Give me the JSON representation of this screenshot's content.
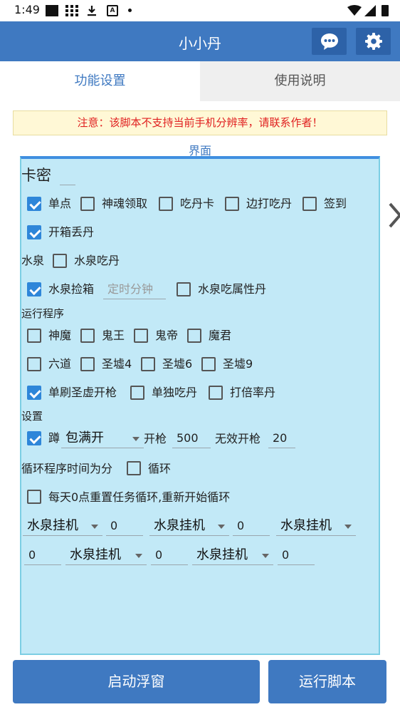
{
  "status": {
    "time": "1:49"
  },
  "app": {
    "title": "小小丹"
  },
  "tabs": [
    {
      "label": "功能设置"
    },
    {
      "label": "使用说明"
    }
  ],
  "notice": "注意：该脚本不支持当前手机分辨率，请联系作者！",
  "section_label": "界面",
  "kami": {
    "label": "卡密",
    "value": ""
  },
  "row1": [
    {
      "label": "单点",
      "checked": true
    },
    {
      "label": "神魂领取",
      "checked": false
    },
    {
      "label": "吃丹卡",
      "checked": false
    },
    {
      "label": "边打吃丹",
      "checked": false
    },
    {
      "label": "签到",
      "checked": false
    }
  ],
  "row2": [
    {
      "label": "开箱丢丹",
      "checked": true
    }
  ],
  "shuiquan": {
    "label": "水泉",
    "option": {
      "label": "水泉吃丹",
      "checked": false
    }
  },
  "row4": {
    "pick": {
      "label": "水泉捡箱",
      "checked": true
    },
    "timer_placeholder": "定时分钟",
    "attr": {
      "label": "水泉吃属性丹",
      "checked": false
    }
  },
  "run_program": {
    "label": "运行程序"
  },
  "row5": [
    {
      "label": "神魔",
      "checked": false
    },
    {
      "label": "鬼王",
      "checked": false
    },
    {
      "label": "鬼帝",
      "checked": false
    },
    {
      "label": "魔君",
      "checked": false
    }
  ],
  "row6": [
    {
      "label": "六道",
      "checked": false
    },
    {
      "label": "圣墟4",
      "checked": false
    },
    {
      "label": "圣墟6",
      "checked": false
    },
    {
      "label": "圣墟9",
      "checked": false
    }
  ],
  "row7": [
    {
      "label": "单刷圣虚开枪",
      "checked": true
    },
    {
      "label": "单独吃丹",
      "checked": false
    },
    {
      "label": "打倍率丹",
      "checked": false
    }
  ],
  "settings": {
    "label": "设置",
    "squat": {
      "label": "蹲",
      "checked": true
    },
    "squat_select": "包满开",
    "fire_label": "开枪",
    "fire_value": "500",
    "invalid_label": "无效开枪",
    "invalid_value": "20"
  },
  "loop": {
    "label": "循环程序时间为分",
    "option": {
      "label": "循环",
      "checked": false
    }
  },
  "reset": {
    "label": "每天0点重置任务循环,重新开始循环",
    "checked": false
  },
  "tasks_row1": [
    {
      "select": "水泉挂机",
      "value": "0"
    },
    {
      "select": "水泉挂机",
      "value": "0"
    },
    {
      "select": "水泉挂机"
    }
  ],
  "tasks_row2": [
    {
      "value": "0",
      "select": "水泉挂机"
    },
    {
      "value": "0",
      "select": "水泉挂机"
    },
    {
      "value": "0"
    }
  ],
  "buttons": {
    "float": "启动浮窗",
    "run": "运行脚本"
  },
  "colors": {
    "primary": "#3F79C1",
    "panel": "#C2E9F7",
    "notice_text": "#E02020",
    "checkbox": "#2E86D9"
  }
}
